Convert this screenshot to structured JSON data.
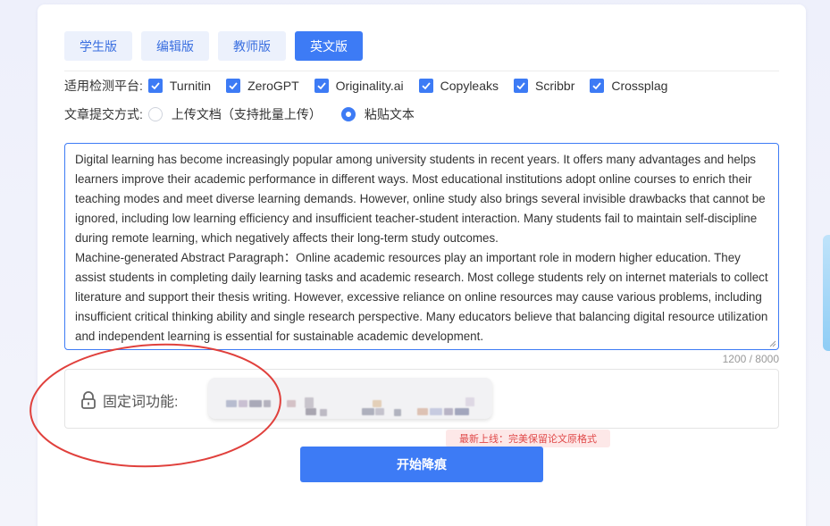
{
  "tabs": [
    {
      "label": "学生版",
      "active": false
    },
    {
      "label": "编辑版",
      "active": false
    },
    {
      "label": "教师版",
      "active": false
    },
    {
      "label": "英文版",
      "active": true
    }
  ],
  "platforms": {
    "label": "适用检测平台:",
    "items": [
      "Turnitin",
      "ZeroGPT",
      "Originality.ai",
      "Copyleaks",
      "Scribbr",
      "Crossplag"
    ]
  },
  "submit_method": {
    "label": "文章提交方式:",
    "options": [
      {
        "label": "上传文档（支持批量上传）",
        "selected": false
      },
      {
        "label": "粘贴文本",
        "selected": true
      }
    ]
  },
  "editor": {
    "text": "Digital learning has become increasingly popular among university students in recent years. It offers many advantages and helps learners improve their academic performance in different ways. Most educational institutions adopt online courses to enrich their teaching modes and meet diverse learning demands. However, online study also brings several invisible drawbacks that cannot be ignored, including low learning efficiency and insufficient teacher-student interaction. Many students fail to maintain self-discipline during remote learning, which negatively affects their long-term study outcomes.\nMachine-generated Abstract Paragraph：Online academic resources play an important role in modern higher education. They assist students in completing daily learning tasks and academic research. Most college students rely on internet materials to collect literature and support their thesis writing. However, excessive reliance on online resources may cause various problems, including insufficient critical thinking ability and single research perspective. Many educators believe that balancing digital resource utilization and independent learning is essential for sustainable academic development.",
    "counter": "1200 / 8000"
  },
  "fixed_words": {
    "label": "固定词功能:"
  },
  "new_tag": "最新上线：完美保留论文原格式",
  "start_button": "开始降痕",
  "colors": {
    "primary": "#3d7bf5",
    "annotation": "#e0403c",
    "tag_bg": "#fde8e8"
  }
}
